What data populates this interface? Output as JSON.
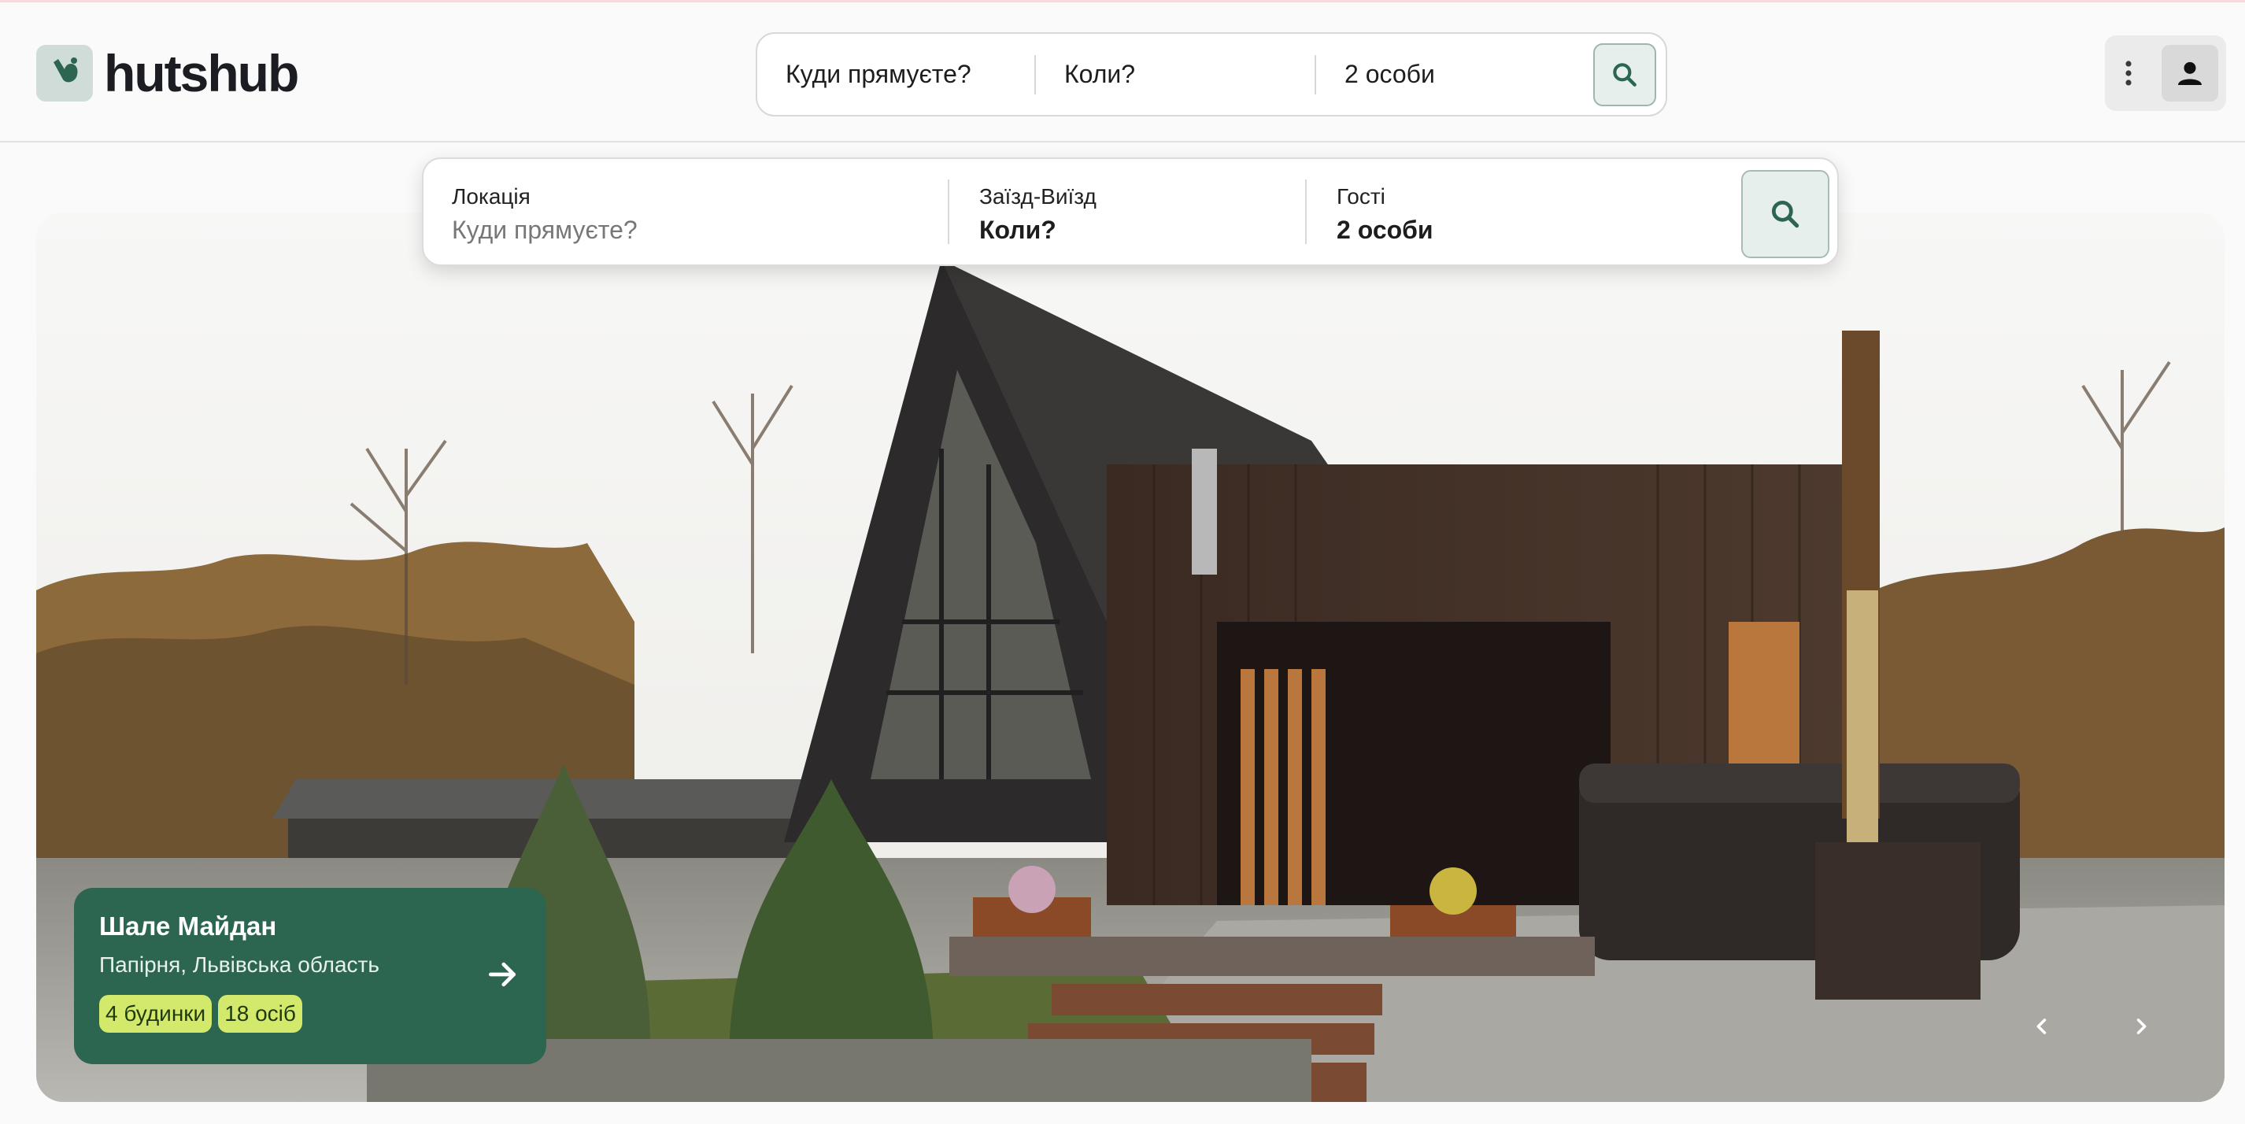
{
  "brand": {
    "name": "hutshub",
    "accent": "#2c6651",
    "accent_light": "#cfdcd7"
  },
  "mini_search": {
    "where": "Куди прямуєте?",
    "when": "Коли?",
    "guests": "2 особи",
    "search_icon": "search-icon"
  },
  "header_actions": {
    "menu_icon": "more-vertical-icon",
    "user_icon": "user-icon"
  },
  "search": {
    "location_label": "Локація",
    "location_placeholder": "Куди прямуєте?",
    "dates_label": "Заїзд-Виїзд",
    "dates_value": "Коли?",
    "guests_label": "Гості",
    "guests_value": "2 особи",
    "search_icon": "search-icon"
  },
  "hero": {
    "image": "a-frame-cabin-photo",
    "card": {
      "title": "Шале Майдан",
      "subtitle": "Папірня, Львівська область",
      "badges": [
        "4 будинки",
        "18 осіб"
      ],
      "badge_color": "#d3e96b",
      "arrow_icon": "arrow-right-icon"
    },
    "prev_icon": "chevron-left-icon",
    "next_icon": "chevron-right-icon"
  }
}
